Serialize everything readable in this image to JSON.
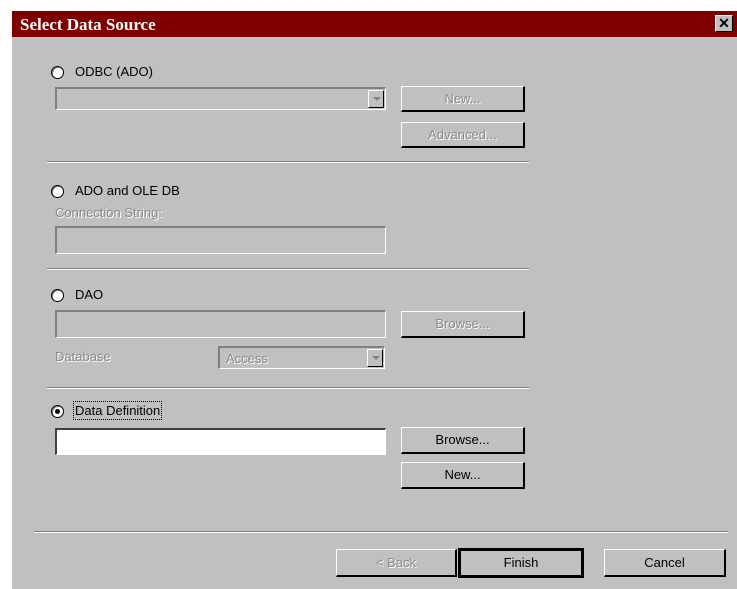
{
  "window": {
    "title": "Select Data Source",
    "close_glyph": "✕"
  },
  "odbc": {
    "label": "ODBC (ADO)",
    "new_label": "New...",
    "advanced_label": "Advanced..."
  },
  "ado": {
    "label": "ADO and OLE DB",
    "connection_string_label": "Connection String:"
  },
  "dao": {
    "label": "DAO",
    "browse_label": "Browse...",
    "database_label": "Database",
    "database_value": "Access"
  },
  "data_definition": {
    "label": "Data Definition",
    "browse_label": "Browse...",
    "new_label": "New...",
    "selected": true
  },
  "footer": {
    "back_label": "< Back",
    "finish_label": "Finish",
    "cancel_label": "Cancel"
  }
}
